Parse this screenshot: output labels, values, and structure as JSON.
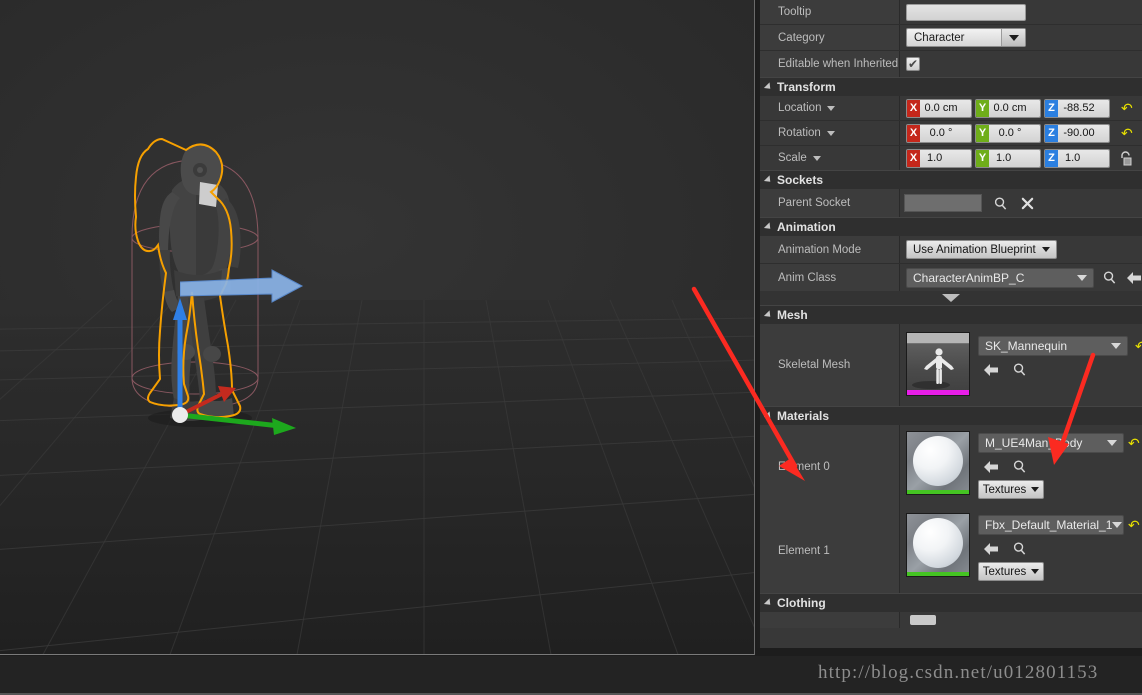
{
  "watermark": "http://blog.csdn.net/u012801153",
  "colors": {
    "accent_x": "#c4271b",
    "accent_y": "#6fae1a",
    "accent_z": "#2b7fe0",
    "panel_bg": "#383838",
    "header_bg": "#2f2f2f",
    "annotation_arrow": "#fb2a21",
    "selection_outline": "#f6a000",
    "reset_arrow": "#e8e000"
  },
  "viewport": {
    "name": "perspective-viewport",
    "gizmo": {
      "x_axis": "red",
      "y_axis": "green",
      "z_axis": "blue"
    }
  },
  "details": {
    "top_rows": [
      {
        "label": "Tooltip",
        "type": "text",
        "value": "",
        "name": "tooltip"
      },
      {
        "label": "Category",
        "type": "combo",
        "value": "Character",
        "name": "category"
      },
      {
        "label": "Editable when Inherited",
        "type": "checkbox",
        "value": "✔",
        "name": "editable-when-inherited"
      }
    ],
    "transform": {
      "title": "Transform",
      "rows": [
        {
          "label": "Location",
          "name": "location",
          "axes": [
            {
              "tag": "X",
              "value": "0.0 cm"
            },
            {
              "tag": "Y",
              "value": "0.0 cm"
            },
            {
              "tag": "Z",
              "value": "-88.52"
            }
          ],
          "has_reset": true,
          "has_lock": false
        },
        {
          "label": "Rotation",
          "name": "rotation",
          "axes": [
            {
              "tag": "X",
              "value": "0.0 °"
            },
            {
              "tag": "Y",
              "value": "0.0 °"
            },
            {
              "tag": "Z",
              "value": "-90.00"
            }
          ],
          "has_reset": true,
          "has_lock": false
        },
        {
          "label": "Scale",
          "name": "scale",
          "axes": [
            {
              "tag": "X",
              "value": "1.0"
            },
            {
              "tag": "Y",
              "value": "1.0"
            },
            {
              "tag": "Z",
              "value": "1.0"
            }
          ],
          "has_reset": false,
          "has_lock": true
        }
      ]
    },
    "sockets": {
      "title": "Sockets",
      "row_label": "Parent Socket",
      "value": "",
      "search_icon": "magnifier-icon",
      "clear_icon": "close-x-icon"
    },
    "animation": {
      "title": "Animation",
      "mode_label": "Animation Mode",
      "mode_value": "Use Animation Blueprint",
      "class_label": "Anim Class",
      "class_value": "CharacterAnimBP_C",
      "browse_icon": "magnifier-icon",
      "back_icon": "arrow-left-icon"
    },
    "mesh": {
      "title": "Mesh",
      "row_label": "Skeletal Mesh",
      "value": "SK_Mannequin",
      "thumbnail": "skeletal-mesh-thumbnail",
      "back_icon": "arrow-left-icon",
      "browse_icon": "magnifier-icon",
      "reset_icon": "reset-arrow-icon"
    },
    "materials": {
      "title": "Materials",
      "elements": [
        {
          "label": "Element 0",
          "value": "M_UE4Man_Body",
          "textures_label": "Textures",
          "name": "material-element-0"
        },
        {
          "label": "Element 1",
          "value": "Fbx_Default_Material_1",
          "textures_label": "Textures",
          "name": "material-element-1"
        }
      ]
    },
    "clothing": {
      "title": "Clothing"
    }
  }
}
